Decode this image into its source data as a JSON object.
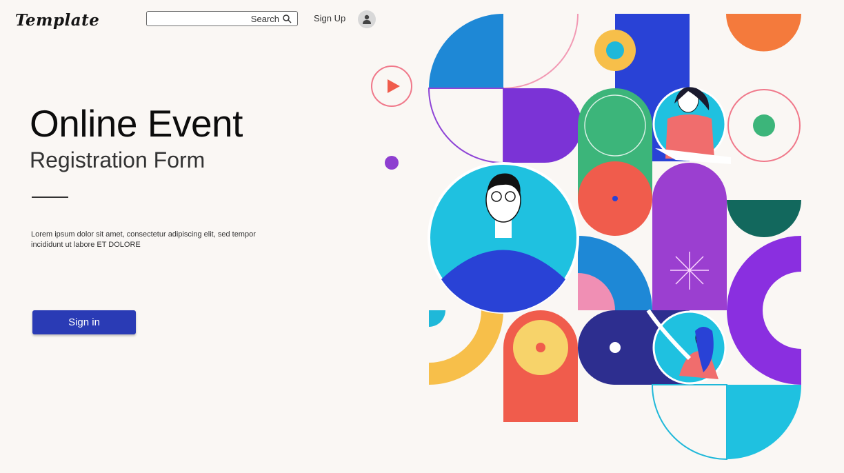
{
  "header": {
    "logo": "Template",
    "search_placeholder": "Search",
    "signup_label": "Sign Up"
  },
  "hero": {
    "title": "Online Event",
    "subtitle": "Registration Form",
    "body": "Lorem ipsum dolor sit amet, consectetur adipiscing elit, sed tempor incididunt ut labore ET DOLORE",
    "signin_label": "Sign in"
  },
  "colors": {
    "accent": "#2a3bb5",
    "background": "#faf7f4"
  }
}
